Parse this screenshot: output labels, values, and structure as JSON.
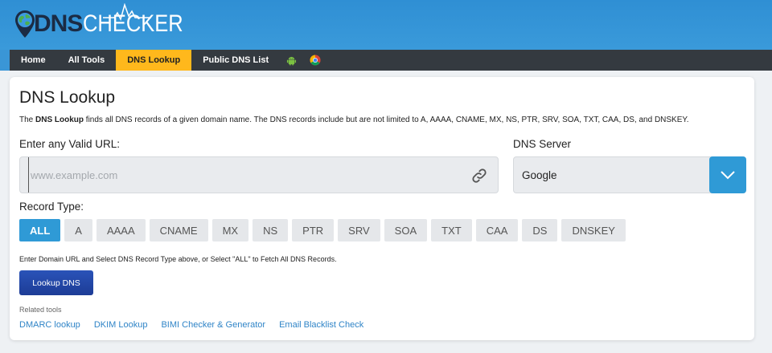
{
  "brand": {
    "logo_dns": "DNS",
    "logo_checker": "CHECKER"
  },
  "nav": {
    "items": [
      {
        "label": "Home",
        "active": false
      },
      {
        "label": "All Tools",
        "active": false
      },
      {
        "label": "DNS Lookup",
        "active": true
      },
      {
        "label": "Public DNS List",
        "active": false
      }
    ],
    "icons": [
      "android-icon",
      "chrome-icon"
    ]
  },
  "main": {
    "title": "DNS Lookup",
    "description_prefix": "The ",
    "description_bold": "DNS Lookup",
    "description_suffix": " finds all DNS records of a given domain name. The DNS records include but are not limited to A, AAAA, CNAME, MX, NS, PTR, SRV, SOA, TXT, CAA, DS, and DNSKEY.",
    "url_label": "Enter any Valid URL:",
    "url_placeholder": "www.example.com",
    "url_value": "",
    "dns_server_label": "DNS Server",
    "dns_server_value": "Google",
    "record_type_label": "Record Type:",
    "record_types": [
      {
        "label": "ALL",
        "active": true
      },
      {
        "label": "A",
        "active": false
      },
      {
        "label": "AAAA",
        "active": false
      },
      {
        "label": "CNAME",
        "active": false
      },
      {
        "label": "MX",
        "active": false
      },
      {
        "label": "NS",
        "active": false
      },
      {
        "label": "PTR",
        "active": false
      },
      {
        "label": "SRV",
        "active": false
      },
      {
        "label": "SOA",
        "active": false
      },
      {
        "label": "TXT",
        "active": false
      },
      {
        "label": "CAA",
        "active": false
      },
      {
        "label": "DS",
        "active": false
      },
      {
        "label": "DNSKEY",
        "active": false
      }
    ],
    "helper_text": "Enter Domain URL and Select DNS Record Type above, or Select \"ALL\" to Fetch All DNS Records.",
    "lookup_button": "Lookup DNS",
    "related_label": "Related tools",
    "related_links": [
      "DMARC lookup",
      "DKIM Lookup",
      "BIMI Checker & Generator",
      "Email Blacklist Check"
    ]
  },
  "colors": {
    "header_blue": "#3a96d6",
    "nav_dark": "#343a40",
    "nav_active": "#ffb81c",
    "accent": "#2f9ad6",
    "button_blue": "#1d3c96",
    "link": "#2f84c7"
  }
}
